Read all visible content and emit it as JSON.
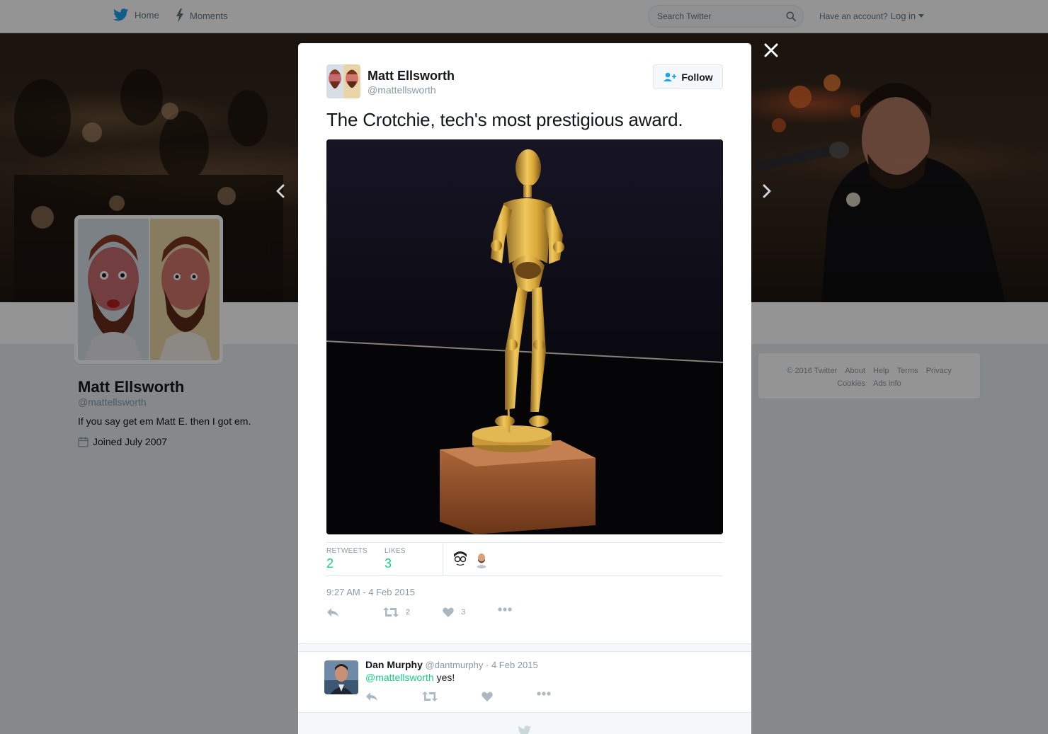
{
  "nav": {
    "home_label": "Home",
    "moments_label": "Moments",
    "search_placeholder": "Search Twitter",
    "have_account": "Have an account?",
    "login_label": "Log in"
  },
  "profile": {
    "name": "Matt Ellsworth",
    "handle": "@mattellsworth",
    "bio": "If you say get em Matt E. then I got em.",
    "joined": "Joined July 2007"
  },
  "footer": {
    "copyright": "© 2016 Twitter",
    "links": [
      "About",
      "Help",
      "Terms",
      "Privacy",
      "Cookies",
      "Ads info"
    ]
  },
  "tweet": {
    "author_name": "Matt Ellsworth",
    "author_handle": "@mattellsworth",
    "follow_label": "Follow",
    "text": "The Crotchie, tech's most prestigious award.",
    "retweets_label": "RETWEETS",
    "retweets_count": "2",
    "likes_label": "LIKES",
    "likes_count": "3",
    "timestamp": "9:27 AM - 4 Feb 2015",
    "action_retweet_count": "2",
    "action_like_count": "3"
  },
  "reply": {
    "name": "Dan Murphy",
    "handle": "@dantmurphy",
    "date": "· 4 Feb 2015",
    "mention": "@mattellsworth",
    "text": " yes!"
  },
  "colors": {
    "accent_green": "#19cf86",
    "twitter_blue": "#1da1f2",
    "muted": "#8899a6"
  }
}
